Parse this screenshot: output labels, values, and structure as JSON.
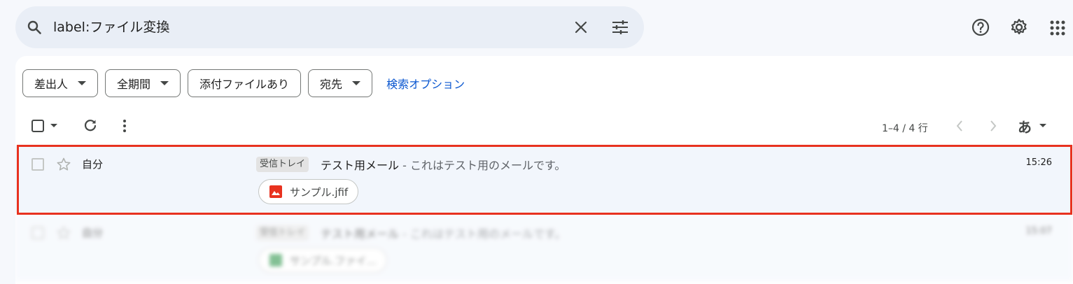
{
  "search": {
    "query": "label:ファイル変換"
  },
  "filters": {
    "chips": [
      {
        "label": "差出人"
      },
      {
        "label": "全期間"
      },
      {
        "label": "添付ファイルあり"
      },
      {
        "label": "宛先"
      }
    ],
    "advanced_link": "検索オプション"
  },
  "toolbar": {
    "count": "1–4 / 4 行",
    "input_tool_label": "あ"
  },
  "emails": [
    {
      "sender": "自分",
      "label": "受信トレイ",
      "subject": "テスト用メール",
      "snippet": " - これはテスト用のメールです。",
      "time": "15:26",
      "attachment": "サンプル.jfif",
      "attachment_icon": "image-icon"
    },
    {
      "sender": "自分",
      "label": "受信トレイ",
      "subject": "テスト用メール",
      "snippet": " - これはテスト用のメールです。",
      "time": "15:07",
      "attachment": "サンプル.ファイ...",
      "attachment_icon": "sheet-icon"
    }
  ],
  "colors": {
    "accent_link": "#0b57d0",
    "highlight_border": "#e8321f",
    "search_bg": "#e9eef6",
    "row_bg": "#f2f6fc"
  }
}
